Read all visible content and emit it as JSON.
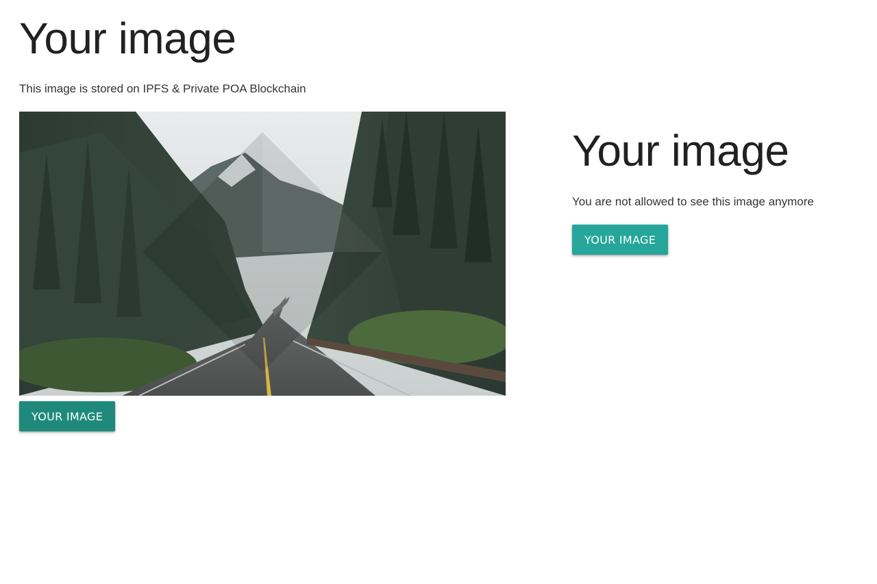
{
  "left_panel": {
    "title": "Your image",
    "subtitle": "This image is stored on IPFS & Private POA Blockchain",
    "image_alt": "Mountain road through pine forest",
    "button_label": "YOUR IMAGE",
    "button_color": "#1f8a7c"
  },
  "right_panel": {
    "title": "Your image",
    "message": "You are not allowed to see this image anymore",
    "button_label": "YOUR IMAGE",
    "button_color": "#26a69a"
  }
}
